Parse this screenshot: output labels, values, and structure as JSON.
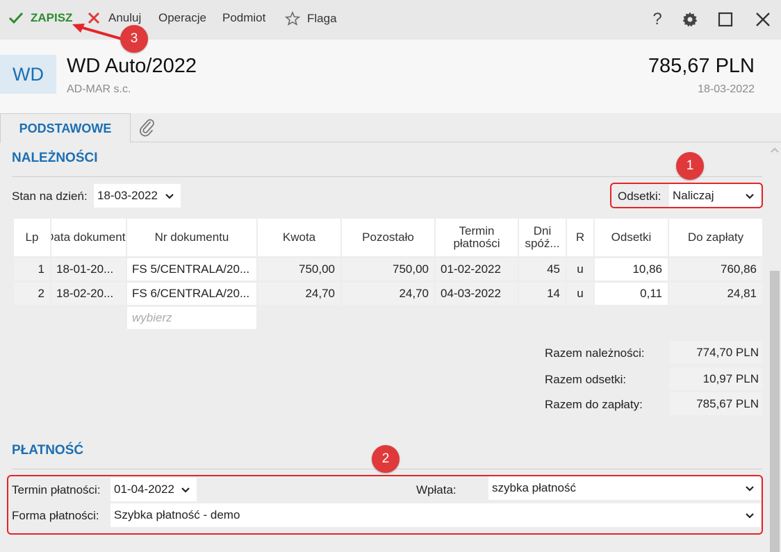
{
  "toolbar": {
    "save_label": "ZAPISZ",
    "cancel_label": "Anuluj",
    "operations_label": "Operacje",
    "subject_label": "Podmiot",
    "flag_label": "Flaga",
    "help_label": "?"
  },
  "header": {
    "badge": "WD",
    "title": "WD Auto/2022",
    "subtitle": "AD-MAR s.c.",
    "amount": "785,67 PLN",
    "date": "18-03-2022"
  },
  "tabs": {
    "basic": "PODSTAWOWE"
  },
  "receivables": {
    "title": "NALEŻNOŚCI",
    "state_label": "Stan na dzień:",
    "state_date": "18-03-2022",
    "interest_label": "Odsetki:",
    "interest_value": "Naliczaj",
    "columns": [
      "Lp",
      "Data dokumentu",
      "Nr dokumentu",
      "Kwota",
      "Pozostało",
      "Termin płatności",
      "Dni spóź...",
      "R",
      "Odsetki",
      "Do zapłaty"
    ],
    "rows": [
      [
        "1",
        "18-01-20...",
        "FS 5/CENTRALA/20...",
        "750,00",
        "750,00",
        "01-02-2022",
        "45",
        "u",
        "10,86",
        "760,86"
      ],
      [
        "2",
        "18-02-20...",
        "FS 6/CENTRALA/20...",
        "24,70",
        "24,70",
        "04-03-2022",
        "14",
        "u",
        "0,11",
        "24,81"
      ]
    ],
    "choose_placeholder": "wybierz",
    "totals": [
      {
        "label": "Razem należności:",
        "value": "774,70 PLN"
      },
      {
        "label": "Razem odsetki:",
        "value": "10,97 PLN"
      },
      {
        "label": "Razem do zapłaty:",
        "value": "785,67 PLN"
      }
    ]
  },
  "payment": {
    "title": "PŁATNOŚĆ",
    "due_label": "Termin płatności:",
    "due_value": "01-04-2022",
    "deposit_label": "Wpłata:",
    "deposit_value": "szybka płatność",
    "method_label": "Forma płatności:",
    "method_value": "Szybka płatność - demo"
  },
  "markers": [
    "1",
    "2",
    "3"
  ],
  "colors": {
    "accent": "#1b6fb3",
    "save_green": "#2e8b2e",
    "cancel_red": "#e0393b",
    "annotation_red": "#e4242a"
  }
}
